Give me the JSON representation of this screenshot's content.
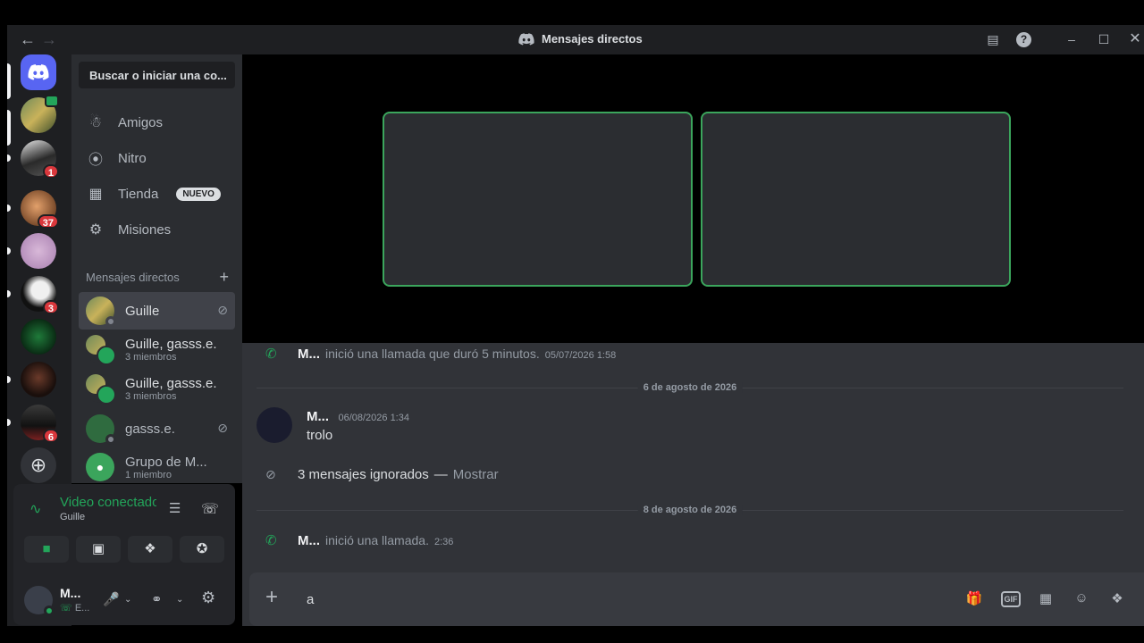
{
  "titlebar": {
    "title": "Mensajes directos",
    "back_icon": "arrow-left-icon",
    "forward_icon": "arrow-right-icon"
  },
  "servers": [
    {
      "name": "discord-home",
      "badge": ""
    },
    {
      "name": "server-1",
      "badge": ""
    },
    {
      "name": "server-2",
      "badge": "1"
    },
    {
      "name": "server-3",
      "badge": "37"
    },
    {
      "name": "server-4",
      "badge": ""
    },
    {
      "name": "server-5",
      "badge": "3"
    },
    {
      "name": "server-6",
      "badge": ""
    },
    {
      "name": "server-7",
      "badge": ""
    },
    {
      "name": "server-8",
      "badge": "6"
    }
  ],
  "sidebar": {
    "search_placeholder": "Buscar o iniciar una co...",
    "nav": [
      {
        "label": "Amigos",
        "icon": "friends-icon"
      },
      {
        "label": "Nitro",
        "icon": "nitro-icon"
      },
      {
        "label": "Tienda",
        "icon": "shop-icon",
        "badge": "NUEVO"
      },
      {
        "label": "Misiones",
        "icon": "quests-icon"
      }
    ],
    "dm_header": "Mensajes directos",
    "dms": [
      {
        "name": "Guille",
        "sub": ""
      },
      {
        "name": "Guille, gasss.e.",
        "sub": "3 miembros"
      },
      {
        "name": "Guille, gasss.e.",
        "sub": "3 miembros"
      },
      {
        "name": "gasss.e.",
        "sub": ""
      },
      {
        "name": "Grupo de M...",
        "sub": "1 miembro"
      }
    ]
  },
  "voice": {
    "title": "Video conectado",
    "sub": "Guille"
  },
  "user": {
    "name": "M...",
    "status": "E..."
  },
  "chat": {
    "call1": {
      "author": "M...",
      "text": "inició una llamada que duró 5 minutos.",
      "ts": "05/07/2026 1:58"
    },
    "divider1": "6 de agosto de 2026",
    "post": {
      "author": "M...",
      "ts": "06/08/2026 1:34",
      "text": "trolo"
    },
    "ignored": {
      "count_text": "3 mensajes ignorados",
      "sep": "—",
      "show": "Mostrar"
    },
    "divider2": "8 de agosto de 2026",
    "call2": {
      "author": "M...",
      "text": "inició una llamada.",
      "ts": "2:36"
    }
  },
  "composer": {
    "value": "a",
    "gif_label": "GIF"
  },
  "colors": {
    "accent_green": "#23a55a",
    "tile_border": "#3ba55c",
    "badge_red": "#da373c",
    "blurple": "#5865f2"
  }
}
